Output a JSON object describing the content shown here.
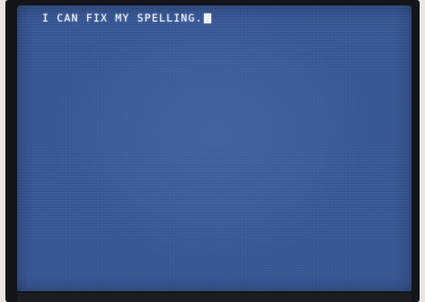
{
  "terminal": {
    "line_text": "I CAN FIX MY SPELLING.",
    "screen_color": "#3a5a98",
    "text_color": "#eef1f8",
    "bezel_color": "#141518"
  }
}
